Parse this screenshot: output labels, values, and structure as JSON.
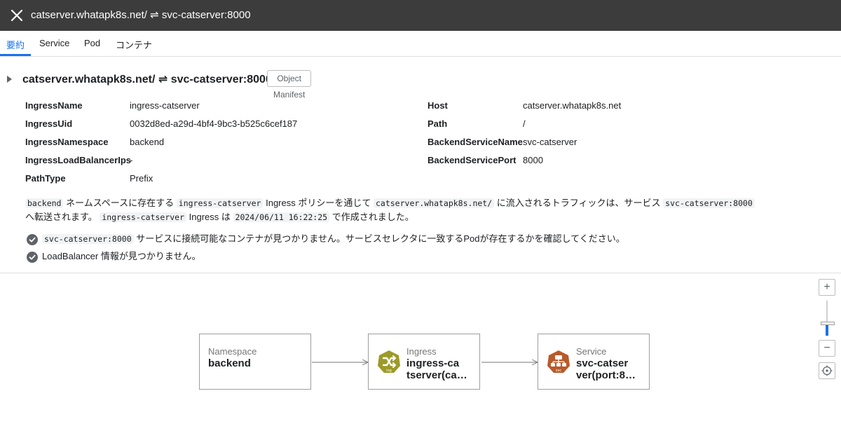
{
  "titlebar": {
    "title": "catserver.whatapk8s.net/ ⇌ svc-catserver:8000"
  },
  "tabs": [
    "要約",
    "Service",
    "Pod",
    "コンテナ"
  ],
  "section": {
    "title": "catserver.whatapk8s.net/ ⇌ svc-catserver:8000",
    "manifest_button": "Object Manifest"
  },
  "left_fields": [
    {
      "key": "IngressName",
      "value": "ingress-catserver"
    },
    {
      "key": "IngressUid",
      "value": "0032d8ed-a29d-4bf4-9bc3-b525c6cef187"
    },
    {
      "key": "IngressNamespace",
      "value": "backend"
    },
    {
      "key": "IngressLoadBalancerIps",
      "value": "-"
    },
    {
      "key": "PathType",
      "value": "Prefix"
    }
  ],
  "right_fields": [
    {
      "key": "Host",
      "value": "catserver.whatapk8s.net"
    },
    {
      "key": "Path",
      "value": "/"
    },
    {
      "key": "BackendServiceName",
      "value": "svc-catserver"
    },
    {
      "key": "BackendServicePort",
      "value": "8000"
    }
  ],
  "description": {
    "ns_code": "backend",
    "t1": "ネームスペースに存在する",
    "ingress_code": "ingress-catserver",
    "t2": "Ingress ポリシーを通じて",
    "host_code": "catserver.whatapk8s.net/",
    "t3": "に流入されるトラフィックは、サービス",
    "svc_code": "svc-catserver:8000",
    "t4": "へ転送されます。",
    "ingress_code2": "ingress-catserver",
    "t5": "Ingress は",
    "date_code": "2024/06/11 16:22:25",
    "t6": "で作成されました。"
  },
  "checks": [
    {
      "code": "svc-catserver:8000",
      "text": "サービスに接続可能なコンテナが見つかりません。サービスセレクタに一致するPodが存在するかを確認してください。"
    },
    {
      "code": "",
      "text": "LoadBalancer 情報が見つかりません。"
    }
  ],
  "graph": {
    "nodes": [
      {
        "type": "Namespace",
        "name_line1": "backend",
        "name_line2": ""
      },
      {
        "type": "Ingress",
        "name_line1": "ingress-ca",
        "name_line2": "tserver(ca…",
        "icon_label": "ing"
      },
      {
        "type": "Service",
        "name_line1": "svc-catser",
        "name_line2": "ver(port:8…",
        "icon_label": "svc"
      }
    ]
  },
  "zoom": {
    "plus": "+",
    "minus": "−",
    "level": 0.3
  },
  "colors": {
    "accent": "#1a73e8",
    "ingress_icon": "#9c9a28",
    "service_icon": "#b85a2a",
    "titlebar": "#3c3c3c"
  }
}
